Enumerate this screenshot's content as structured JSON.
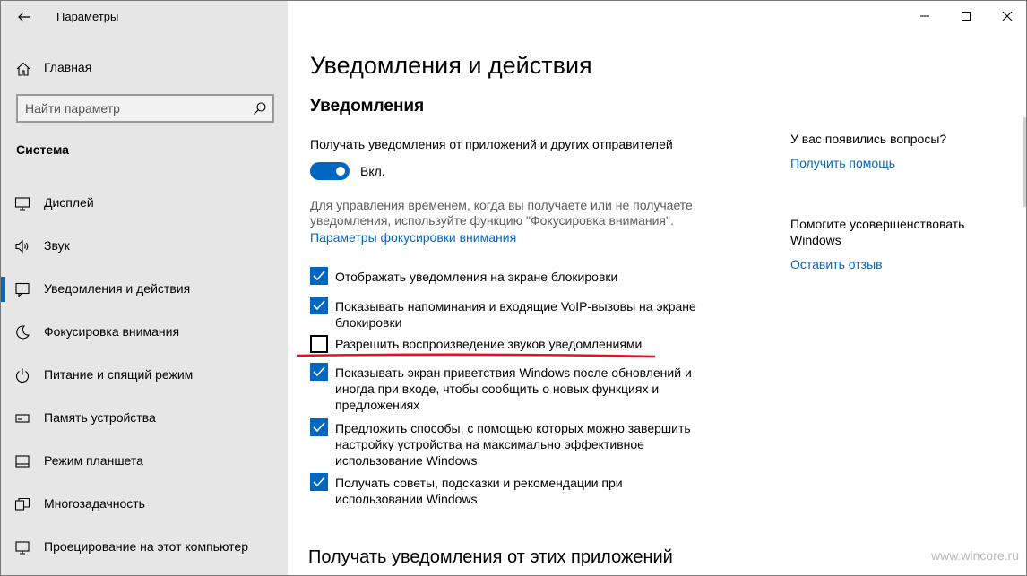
{
  "window": {
    "app_title": "Параметры"
  },
  "sidebar": {
    "home_label": "Главная",
    "search_placeholder": "Найти параметр",
    "section": "Система",
    "items": [
      {
        "label": "Дисплей",
        "icon": "monitor-icon"
      },
      {
        "label": "Звук",
        "icon": "speaker-icon"
      },
      {
        "label": "Уведомления и действия",
        "icon": "notification-icon",
        "selected": true
      },
      {
        "label": "Фокусировка внимания",
        "icon": "moon-icon"
      },
      {
        "label": "Питание и спящий режим",
        "icon": "power-icon"
      },
      {
        "label": "Память устройства",
        "icon": "storage-icon"
      },
      {
        "label": "Режим планшета",
        "icon": "tablet-icon"
      },
      {
        "label": "Многозадачность",
        "icon": "multitask-icon"
      },
      {
        "label": "Проецирование на этот компьютер",
        "icon": "project-icon"
      }
    ]
  },
  "main": {
    "page_title": "Уведомления и действия",
    "section_title": "Уведомления",
    "get_notifications_label": "Получать уведомления от приложений и других отправителей",
    "toggle_state": "Вкл.",
    "focus_hint_line1": "Для управления временем, когда вы получаете или не получаете",
    "focus_hint_line2": "уведомления, используйте функцию \"Фокусировка внимания\".",
    "focus_link": "Параметры фокусировки внимания",
    "checkboxes": [
      {
        "lines": [
          "Отображать уведомления на экране блокировки"
        ],
        "checked": true
      },
      {
        "lines": [
          "Показывать напоминания и входящие VoIP-вызовы на экране",
          "блокировки"
        ],
        "checked": true
      },
      {
        "lines": [
          "Разрешить  воспроизведение звуков уведомлениями"
        ],
        "checked": false
      },
      {
        "lines": [
          "Показывать экран приветствия Windows после обновлений и",
          "иногда при входе, чтобы сообщить о новых функциях и",
          "предложениях"
        ],
        "checked": true
      },
      {
        "lines": [
          "Предложить способы, с помощью которых можно завершить",
          "настройку устройства на максимально эффективное",
          "использование Windows"
        ],
        "checked": true
      },
      {
        "lines": [
          "Получать советы, подсказки и рекомендации при",
          "использовании Windows"
        ],
        "checked": true
      }
    ],
    "apps_title": "Получать уведомления от этих приложений"
  },
  "help": {
    "question": "У вас появились вопросы?",
    "get_help": "Получить помощь",
    "improve_line1": "Помогите усовершенствовать",
    "improve_line2": "Windows",
    "feedback": "Оставить отзыв"
  },
  "watermark": "www.wincore.ru",
  "colors": {
    "accent": "#0067c0",
    "sidebar_bg": "#e6e6e6",
    "annotation_red": "#e81123"
  }
}
